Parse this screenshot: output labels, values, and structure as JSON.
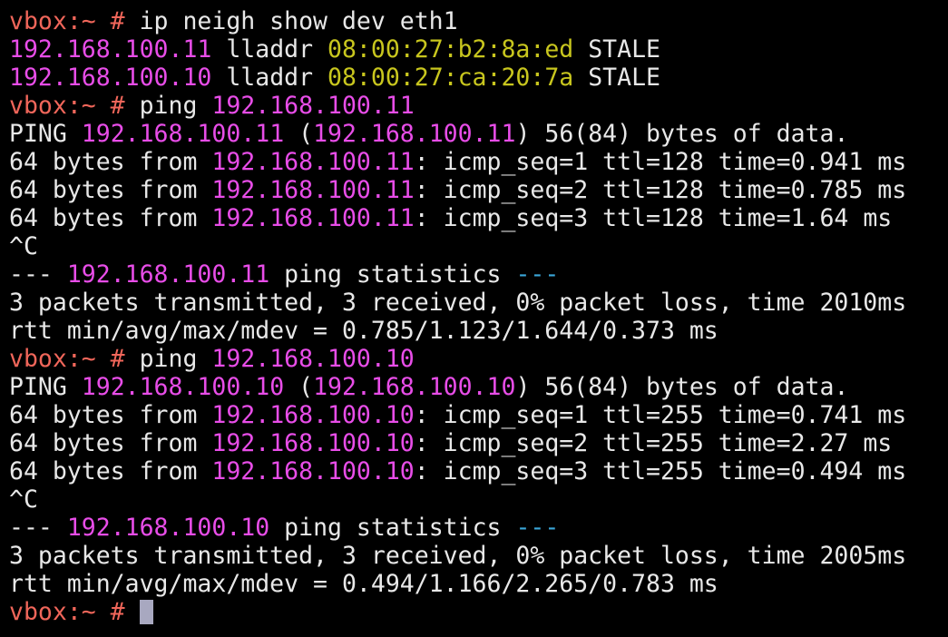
{
  "prompt": "vbox:~ # ",
  "commands": {
    "neigh": "ip neigh show dev eth1",
    "ping_cmd": "ping ",
    "ping1_target": "192.168.100.11",
    "ping2_target": "192.168.100.10"
  },
  "neighbors": [
    {
      "ip": "192.168.100.11",
      "lladdr_label": " lladdr ",
      "mac": "08:00:27:b2:8a:ed",
      "state": " STALE"
    },
    {
      "ip": "192.168.100.10",
      "lladdr_label": " lladdr ",
      "mac": "08:00:27:ca:20:7a",
      "state": " STALE"
    }
  ],
  "ping1": {
    "header_prefix": "PING ",
    "ip": "192.168.100.11",
    "header_mid": " (",
    "header_suffix": ") 56(84) bytes of data.",
    "reply_prefix": "64 bytes from ",
    "replies": [
      ": icmp_seq=1 ttl=128 time=0.941 ms",
      ": icmp_seq=2 ttl=128 time=0.785 ms",
      ": icmp_seq=3 ttl=128 time=1.64 ms"
    ],
    "interrupt": "^C",
    "stats_open": "--- ",
    "stats_text": " ping statistics ",
    "stats_close": "---",
    "summary": "3 packets transmitted, 3 received, 0% packet loss, time 2010ms",
    "rtt": "rtt min/avg/max/mdev = 0.785/1.123/1.644/0.373 ms"
  },
  "ping2": {
    "header_prefix": "PING ",
    "ip": "192.168.100.10",
    "header_mid": " (",
    "header_suffix": ") 56(84) bytes of data.",
    "reply_prefix": "64 bytes from ",
    "replies": [
      ": icmp_seq=1 ttl=255 time=0.741 ms",
      ": icmp_seq=2 ttl=255 time=2.27 ms",
      ": icmp_seq=3 ttl=255 time=0.494 ms"
    ],
    "interrupt": "^C",
    "stats_open": "--- ",
    "stats_text": " ping statistics ",
    "stats_close": "---",
    "summary": "3 packets transmitted, 3 received, 0% packet loss, time 2005ms",
    "rtt": "rtt min/avg/max/mdev = 0.494/1.166/2.265/0.783 ms"
  },
  "colors": {
    "background": "#000000",
    "text": "#e8e8e8",
    "prompt": "#f0665a",
    "ip": "#e84de8",
    "mac": "#c8c61e",
    "dashes": "#3aa6d8",
    "cursor": "#a8a8c0"
  }
}
